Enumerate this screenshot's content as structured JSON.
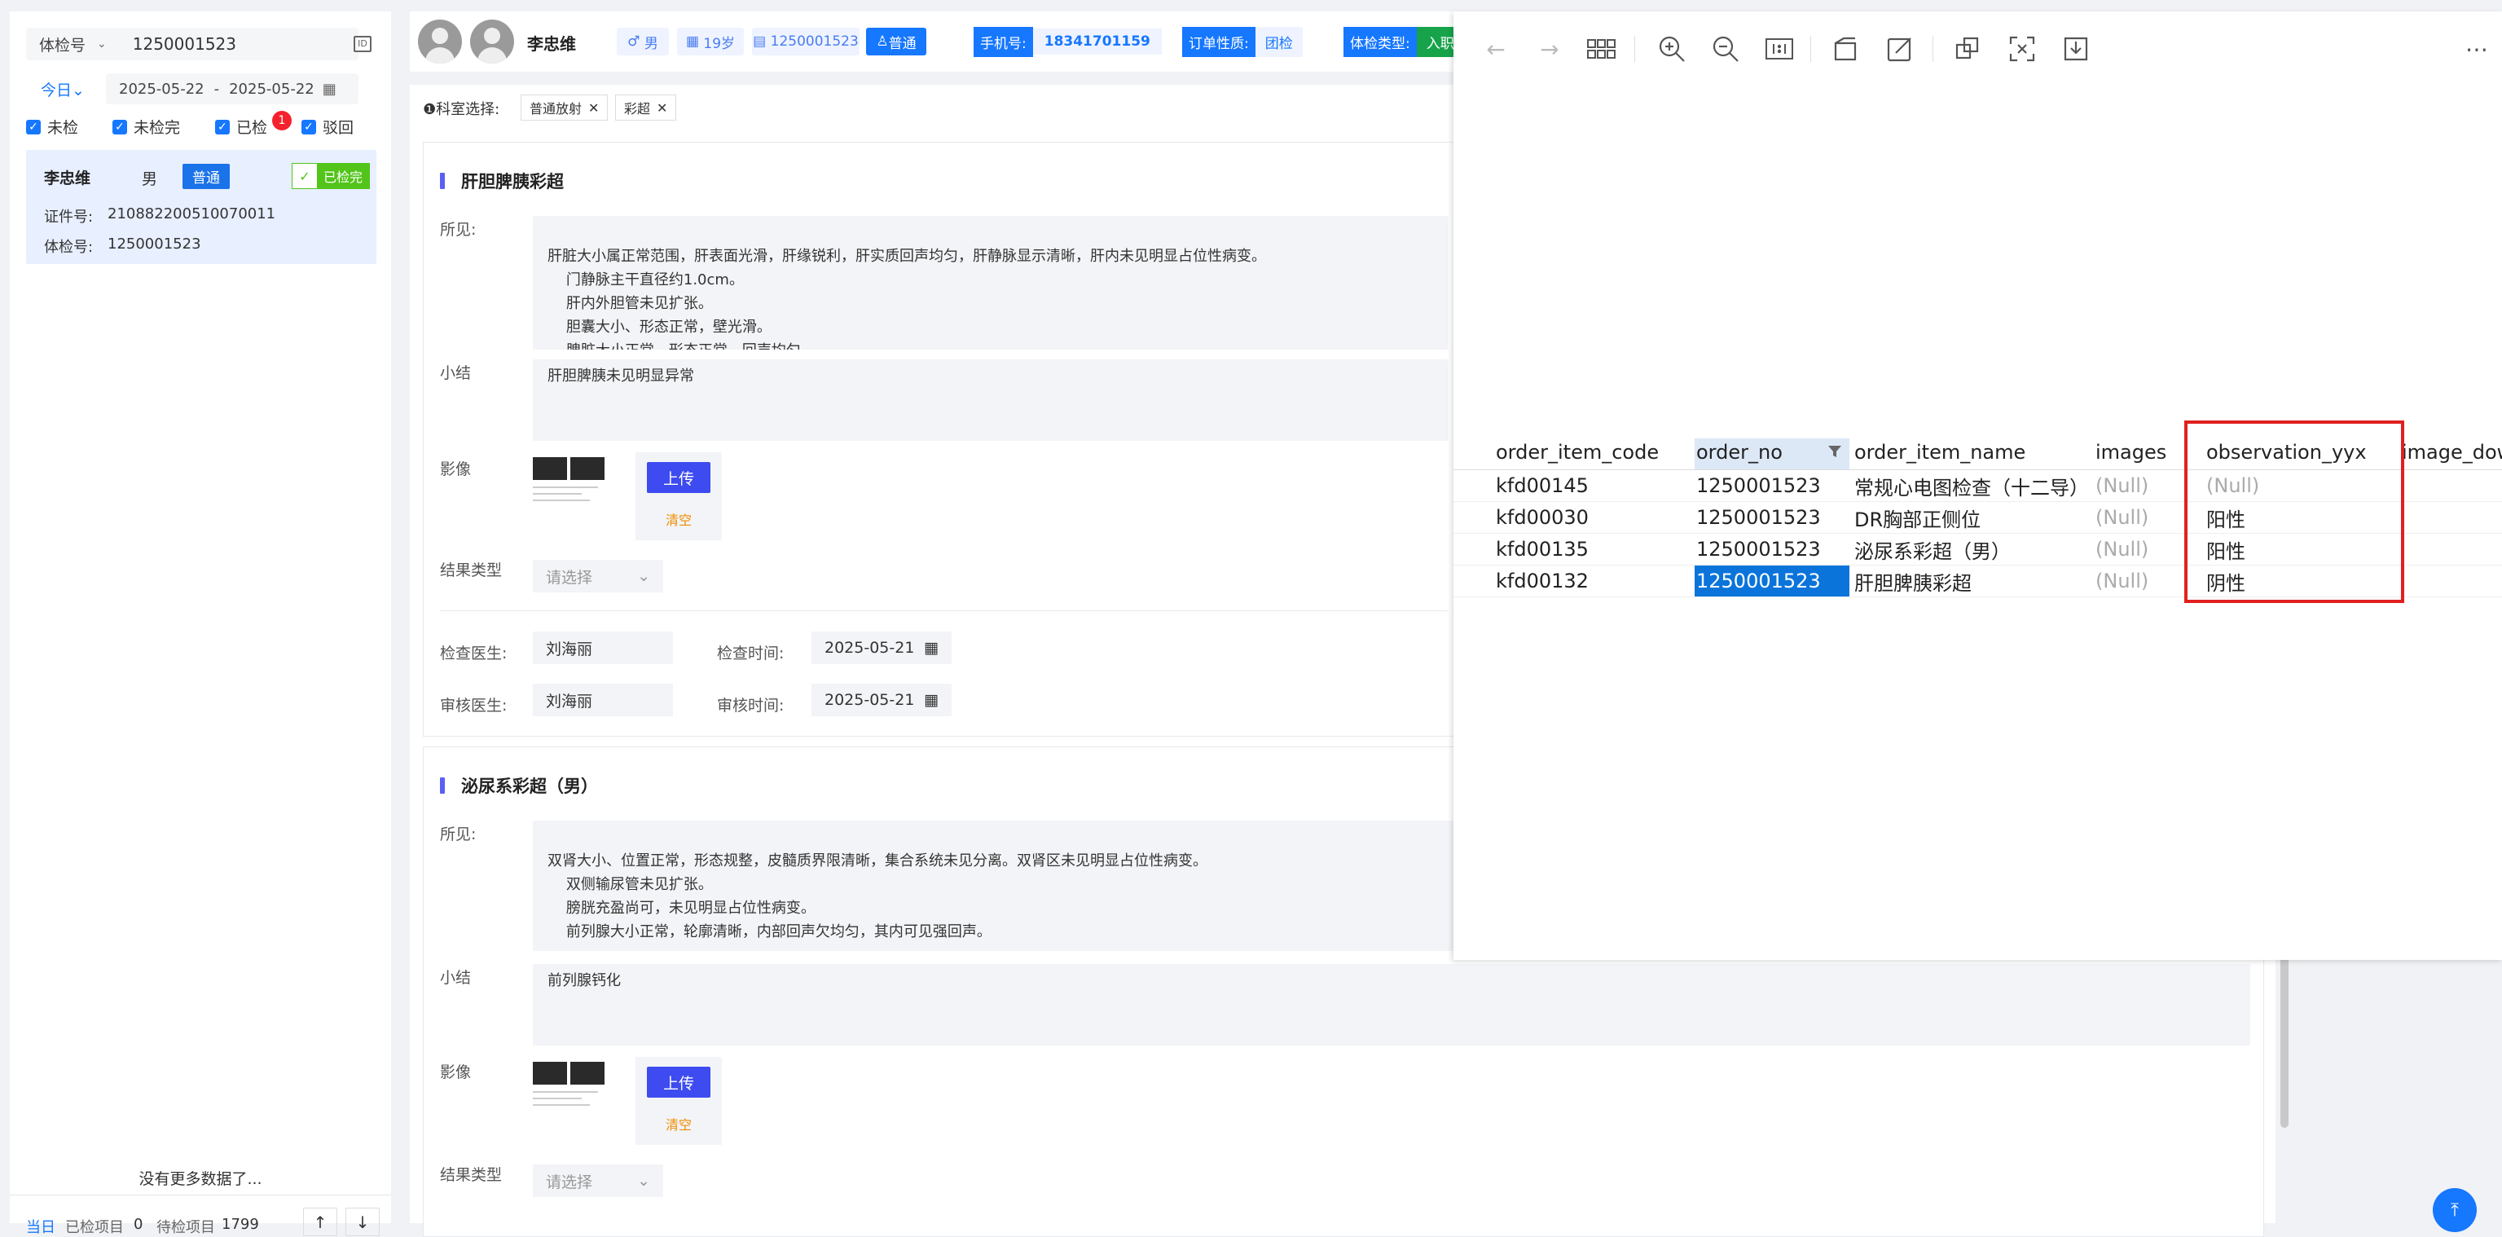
{
  "left": {
    "search_type": "体检号",
    "search_value": "1250001523",
    "date_range_label": "今日",
    "date_start": "2025-05-22",
    "date_sep": "-",
    "date_end": "2025-05-22",
    "filters": [
      {
        "label": "未检",
        "checked": true
      },
      {
        "label": "未检完",
        "checked": true
      },
      {
        "label": "已检",
        "checked": true,
        "badge": "1"
      },
      {
        "label": "驳回",
        "checked": true
      }
    ],
    "patient_card": {
      "name": "李忠维",
      "gender": "男",
      "level": "普通",
      "status": "已检完",
      "id_label": "证件号:",
      "id_value": "210882200510070011",
      "exam_label": "体检号:",
      "exam_value": "1250001523"
    },
    "no_more": "没有更多数据了...",
    "footer": {
      "today": "当日",
      "checked_label": "已检项目",
      "checked_value": "0",
      "pending_label": "待检项目",
      "pending_value": "1799"
    }
  },
  "header": {
    "name": "李忠维",
    "gender": "男",
    "age": "19岁",
    "exam_no": "1250001523",
    "level": "普通",
    "phone_label": "手机号:",
    "phone_value": "18341701159",
    "order_label": "订单性质:",
    "order_value": "团检",
    "type_label": "体检类型:",
    "type_value": "入职"
  },
  "dept": {
    "label": "❶科室选择:",
    "tags": [
      "普通放射",
      "彩超"
    ]
  },
  "sections": [
    {
      "title": "肝胆脾胰彩超",
      "finding_label": "所见:",
      "finding_lines": [
        "肝脏大小属正常范围，肝表面光滑，肝缘锐利，肝实质回声均匀，肝静脉显示清晰，肝内未见明显占位性病变。",
        "    门静脉主干直径约1.0cm。",
        "    肝内外胆管未见扩张。",
        "    胆囊大小、形态正常，壁光滑。",
        "    脾脏大小正常、形态正常，回声均匀。"
      ],
      "summary_label": "小结",
      "summary": "肝胆脾胰未见明显异常",
      "image_label": "影像",
      "upload": "上传",
      "clear": "清空",
      "result_label": "结果类型",
      "result_placeholder": "请选择",
      "doctor_label": "检查医生:",
      "doctor": "刘海丽",
      "time_label": "检查时间:",
      "time": "2025-05-21",
      "reviewer_label": "审核医生:",
      "reviewer": "刘海丽",
      "review_time_label": "审核时间:",
      "review_time": "2025-05-21"
    },
    {
      "title": "泌尿系彩超（男）",
      "finding_label": "所见:",
      "finding_lines": [
        "双肾大小、位置正常，形态规整，皮髓质界限清晰，集合系统未见分离。双肾区未见明显占位性病变。",
        "    双侧输尿管未见扩张。",
        "    膀胱充盈尚可，未见明显占位性病变。",
        "    前列腺大小正常，轮廓清晰，内部回声欠均匀，其内可见强回声。"
      ],
      "summary_label": "小结",
      "summary": "前列腺钙化",
      "image_label": "影像",
      "upload": "上传",
      "clear": "清空",
      "result_label": "结果类型",
      "result_placeholder": "请选择"
    }
  ],
  "viewer": {
    "columns": [
      "order_item_code",
      "order_no",
      "order_item_name",
      "images",
      "observation_yyx",
      "image_dow"
    ],
    "rows": [
      {
        "code": "kfd00145",
        "no": "1250001523",
        "name": "常规心电图检查（十二导）",
        "images": "(Null)",
        "obs": "(Null)",
        "obs_null": true
      },
      {
        "code": "kfd00030",
        "no": "1250001523",
        "name": "DR胸部正侧位",
        "images": "(Null)",
        "obs": "阳性",
        "obs_null": false
      },
      {
        "code": "kfd00135",
        "no": "1250001523",
        "name": "泌尿系彩超（男）",
        "images": "(Null)",
        "obs": "阳性",
        "obs_null": false
      },
      {
        "code": "kfd00132",
        "no": "1250001523",
        "name": "肝胆脾胰彩超",
        "images": "(Null)",
        "obs": "阴性",
        "obs_null": false
      }
    ],
    "highlight_color": "#e02020",
    "selected_color": "#0a74da"
  }
}
